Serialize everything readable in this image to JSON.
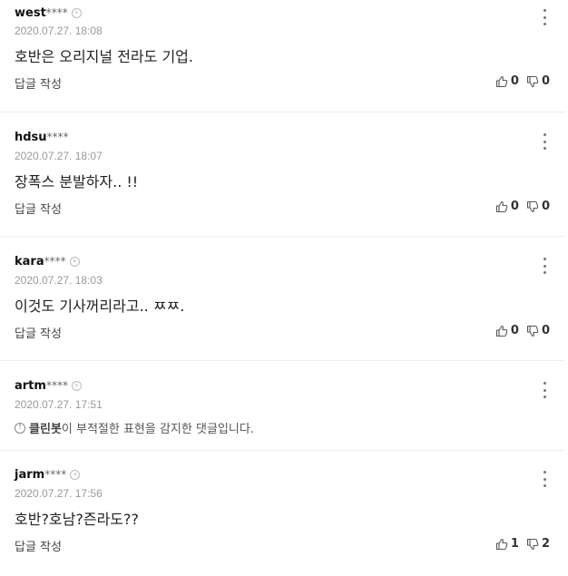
{
  "comments": [
    {
      "user": "west",
      "mask": "****",
      "date": "2020.07.27. 18:08",
      "text": "호반은 오리지널 전라도 기업.",
      "reply_label": "답글 작성",
      "likes": "0",
      "dislikes": "0"
    },
    {
      "user": "hdsu",
      "mask": "****",
      "date": "2020.07.27. 18:07",
      "text": "장폭스 분발하자.. !!",
      "reply_label": "답글 작성",
      "likes": "0",
      "dislikes": "0"
    },
    {
      "user": "kara",
      "mask": "****",
      "date": "2020.07.27. 18:03",
      "text": "이것도 기사꺼리라고.. ㅉㅉ.",
      "reply_label": "답글 작성",
      "likes": "0",
      "dislikes": "0"
    },
    {
      "user": "artm",
      "mask": "****",
      "date": "2020.07.27. 17:51",
      "notice_icon": "exclamation-circle-icon",
      "notice_brand": "클린봇",
      "notice_rest": "이 부적절한 표현을 감지한 댓글입니다."
    },
    {
      "user": "jarm",
      "mask": "****",
      "date": "2020.07.27. 17:56",
      "text": "호반?호남?즌라도??",
      "reply_label": "답글 작성",
      "likes": "1",
      "dislikes": "2"
    }
  ],
  "icons": {
    "profile": "chevron-right-circle-icon",
    "more": "more-vertical-icon",
    "like": "thumbs-up-icon",
    "dislike": "thumbs-down-icon"
  }
}
